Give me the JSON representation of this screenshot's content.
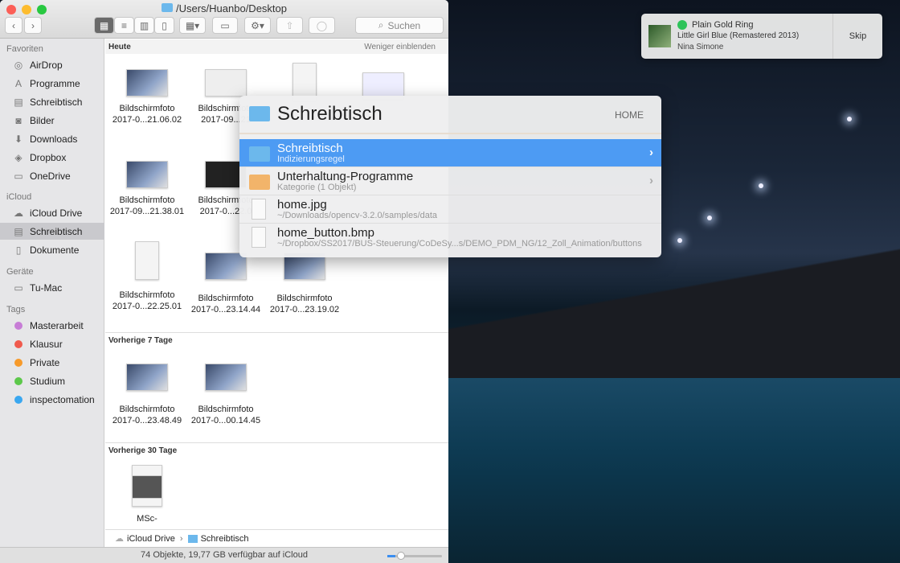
{
  "window": {
    "title": "/Users/Huanbo/Desktop",
    "search_placeholder": "Suchen"
  },
  "sidebar": {
    "favorites_header": "Favoriten",
    "favorites": [
      {
        "label": "AirDrop",
        "icon": "airdrop-icon"
      },
      {
        "label": "Programme",
        "icon": "applications-icon"
      },
      {
        "label": "Schreibtisch",
        "icon": "desktop-icon"
      },
      {
        "label": "Bilder",
        "icon": "camera-icon"
      },
      {
        "label": "Downloads",
        "icon": "download-icon"
      },
      {
        "label": "Dropbox",
        "icon": "dropbox-icon"
      },
      {
        "label": "OneDrive",
        "icon": "folder-icon"
      }
    ],
    "icloud_header": "iCloud",
    "icloud": [
      {
        "label": "iCloud Drive"
      },
      {
        "label": "Schreibtisch"
      },
      {
        "label": "Dokumente"
      }
    ],
    "devices_header": "Geräte",
    "devices": [
      {
        "label": "Tu-Mac"
      }
    ],
    "tags_header": "Tags",
    "tags": [
      {
        "label": "Masterarbeit",
        "color": "#c77dd6"
      },
      {
        "label": "Klausur",
        "color": "#f05a4d"
      },
      {
        "label": "Private",
        "color": "#f79a2a"
      },
      {
        "label": "Studium",
        "color": "#5cc84a"
      },
      {
        "label": "inspectomation",
        "color": "#3aa7f0"
      }
    ]
  },
  "content": {
    "show_less": "Weniger einblenden",
    "sections": [
      {
        "title": "Heute",
        "items": [
          {
            "name": "Bildschirmfoto",
            "date": "2017-0...21.06.02"
          },
          {
            "name": "Bildschirmfoto",
            "date": "2017-09...21"
          },
          {
            "name": "",
            "date": ""
          },
          {
            "name": "",
            "date": ""
          },
          {
            "name": "Bildschirmfoto",
            "date": "2017-09...21.38.01"
          },
          {
            "name": "Bildschirmfoto",
            "date": "2017-0...22.0"
          },
          {
            "name": "Bildschirmfoto",
            "date": "2017-0...22.25.01"
          },
          {
            "name": "Bildschirmfoto",
            "date": "2017-0...23.14.44"
          },
          {
            "name": "Bildschirmfoto",
            "date": "2017-0...23.19.02"
          }
        ]
      },
      {
        "title": "Vorherige 7 Tage",
        "items": [
          {
            "name": "Bildschirmfoto",
            "date": "2017-0...23.48.49"
          },
          {
            "name": "Bildschirmfoto",
            "date": "2017-0...00.14.45"
          }
        ]
      },
      {
        "title": "Vorherige 30 Tage",
        "items": [
          {
            "name": "MSc-",
            "date": ""
          }
        ]
      }
    ]
  },
  "pathbar": {
    "root": "iCloud Drive",
    "current": "Schreibtisch"
  },
  "status": {
    "text": "74 Objekte, 19,77 GB verfügbar auf iCloud",
    "icon_size": 0.15
  },
  "spotlight": {
    "query": "Schreibtisch",
    "scope": "HOME",
    "results": [
      {
        "title": "Schreibtisch",
        "subtitle": "Indizierungsregel"
      },
      {
        "title": "Unterhaltung-Programme",
        "subtitle": "Kategorie (1 Objekt)"
      },
      {
        "title": "home.jpg",
        "subtitle": "~/Downloads/opencv-3.2.0/samples/data"
      },
      {
        "title": "home_button.bmp",
        "subtitle": "~/Dropbox/SS2017/BUS-Steuerung/CoDeSy...s/DEMO_PDM_NG/12_Zoll_Animation/buttons"
      }
    ]
  },
  "notification": {
    "song": "Plain Gold Ring",
    "album": "Little Girl Blue (Remastered 2013)",
    "artist": "Nina Simone",
    "action": "Skip"
  }
}
